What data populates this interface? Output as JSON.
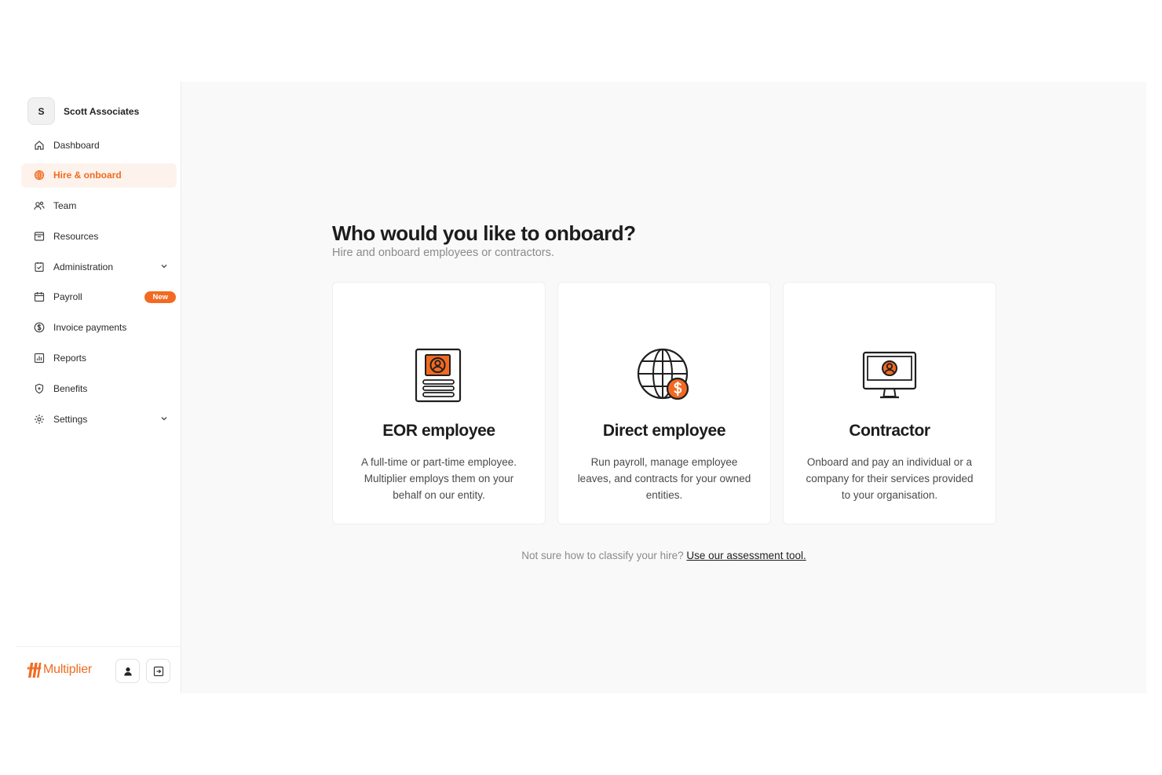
{
  "org": {
    "initial": "S",
    "name": "Scott Associates"
  },
  "nav": {
    "items": [
      {
        "label": "Dashboard"
      },
      {
        "label": "Hire & onboard"
      },
      {
        "label": "Team"
      },
      {
        "label": "Resources"
      },
      {
        "label": "Administration"
      },
      {
        "label": "Payroll",
        "badge": "New"
      },
      {
        "label": "Invoice payments"
      },
      {
        "label": "Reports"
      },
      {
        "label": "Benefits"
      },
      {
        "label": "Settings"
      }
    ]
  },
  "brand": {
    "name": "Multiplier",
    "accent": "#f26a21"
  },
  "main": {
    "title": "Who would you like to onboard?",
    "subtitle": "Hire and onboard employees or contractors.",
    "cards": [
      {
        "title": "EOR employee",
        "description": "A full-time or part-time employee. Multiplier employs them on your behalf on our entity."
      },
      {
        "title": "Direct employee",
        "description": "Run payroll, manage employee leaves, and contracts for your owned entities."
      },
      {
        "title": "Contractor",
        "description": "Onboard and pay an individual or a company for their services provided to your organisation."
      }
    ],
    "note": "Not sure how to classify your hire?",
    "note_link": "Use our assessment tool."
  }
}
